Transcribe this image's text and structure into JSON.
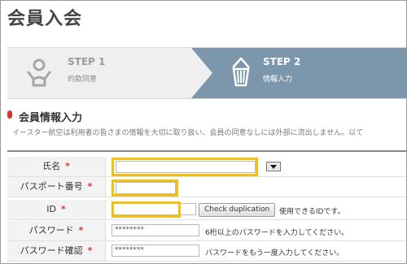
{
  "page": {
    "title": "会員入会"
  },
  "steps": [
    {
      "number": "STEP 1",
      "name": "約款同意",
      "icon": "person-icon"
    },
    {
      "number": "STEP 2",
      "name": "情報入力",
      "icon": "pencil-icon"
    }
  ],
  "section": {
    "title": "会員情報入力",
    "description": "イースター航空は利用者の皆さまの情報を大切に取り扱い、会員の同意なしには外部に流出しません。以て"
  },
  "form": {
    "name": {
      "label": "氏名",
      "required": "*",
      "value": ""
    },
    "passport": {
      "label": "パスポート番号",
      "required": "*",
      "value": ""
    },
    "id": {
      "label": "ID",
      "required": "*",
      "value": "",
      "check_button": "Check duplication",
      "help": "使用できるIDです。"
    },
    "password": {
      "label": "パスワード",
      "required": "*",
      "value": "********",
      "help": "6桁以上のパスワードを入力してください。"
    },
    "password_confirm": {
      "label": "パスワード確認",
      "required": "*",
      "value": "********",
      "help": "パスワードをもう一度入力してください。"
    }
  },
  "colors": {
    "highlight": "#f2c10d",
    "required": "#d9352b",
    "step_active": "#7c97ab"
  }
}
